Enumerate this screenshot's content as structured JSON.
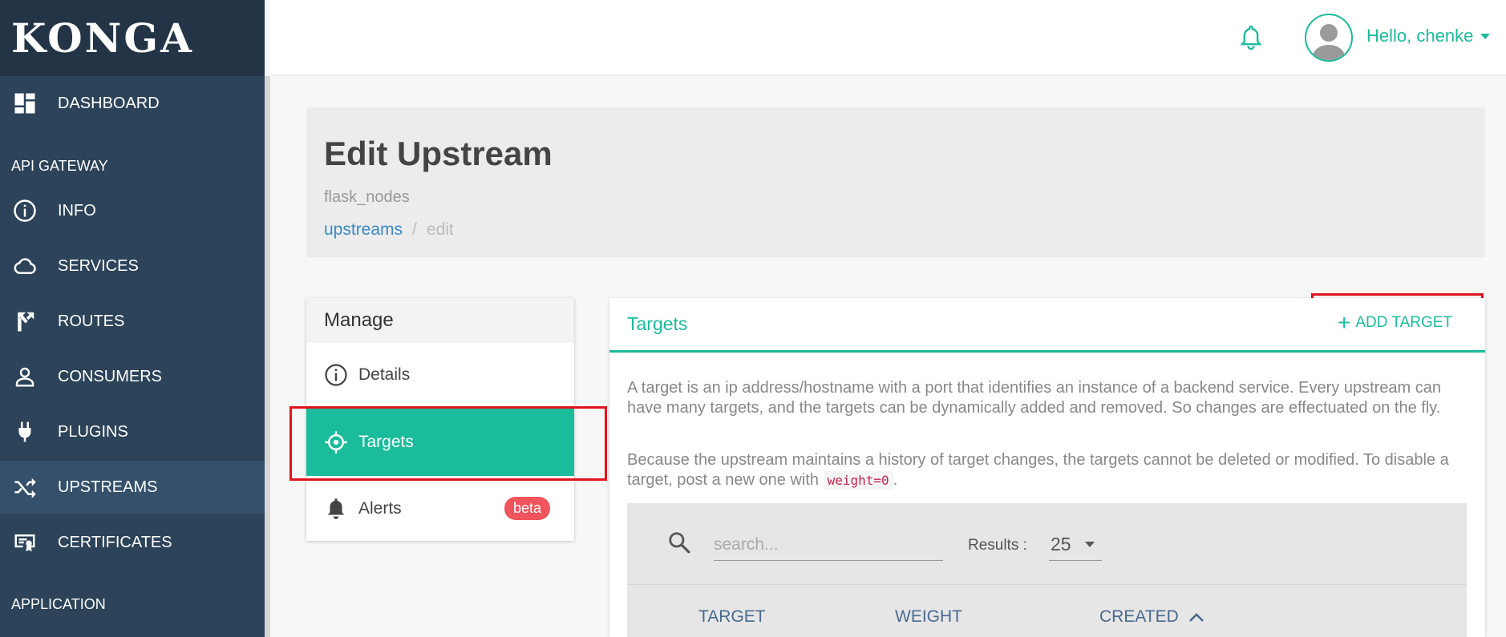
{
  "app": {
    "logo": "KONGA"
  },
  "sidebar": {
    "dashboard": "DASHBOARD",
    "section_api": "API GATEWAY",
    "items": [
      {
        "label": "INFO",
        "icon": "info-icon"
      },
      {
        "label": "SERVICES",
        "icon": "cloud-icon"
      },
      {
        "label": "ROUTES",
        "icon": "routes-icon"
      },
      {
        "label": "CONSUMERS",
        "icon": "user-icon"
      },
      {
        "label": "PLUGINS",
        "icon": "plug-icon"
      },
      {
        "label": "UPSTREAMS",
        "icon": "shuffle-icon",
        "active": true
      },
      {
        "label": "CERTIFICATES",
        "icon": "certificate-icon"
      }
    ],
    "section_app": "APPLICATION"
  },
  "topbar": {
    "greeting": "Hello, chenke"
  },
  "header": {
    "title": "Edit Upstream",
    "subtitle": "flask_nodes",
    "breadcrumb": {
      "link": "upstreams",
      "separator": "/",
      "current": "edit"
    }
  },
  "manage": {
    "title": "Manage",
    "items": [
      {
        "label": "Details"
      },
      {
        "label": "Targets",
        "active": true
      },
      {
        "label": "Alerts",
        "badge": "beta"
      }
    ]
  },
  "targets": {
    "title": "Targets",
    "add_button": "ADD TARGET",
    "desc1": "A target is an ip address/hostname with a port that identifies an instance of a backend service. Every upstream can have many targets, and the targets can be dynamically added and removed. So changes are effectuated on the fly.",
    "desc2_before": "Because the upstream maintains a history of target changes, the targets cannot be deleted or modified. To disable a target, post a new one with ",
    "desc2_code": "weight=0",
    "desc2_after": ".",
    "search_placeholder": "search...",
    "results_label": "Results :",
    "results_value": "25",
    "columns": [
      "TARGET",
      "WEIGHT",
      "CREATED"
    ]
  },
  "colors": {
    "accent": "#1abc9c",
    "sidebar": "#2c4359",
    "badge": "#f0545c",
    "highlight": "#e0141e"
  }
}
